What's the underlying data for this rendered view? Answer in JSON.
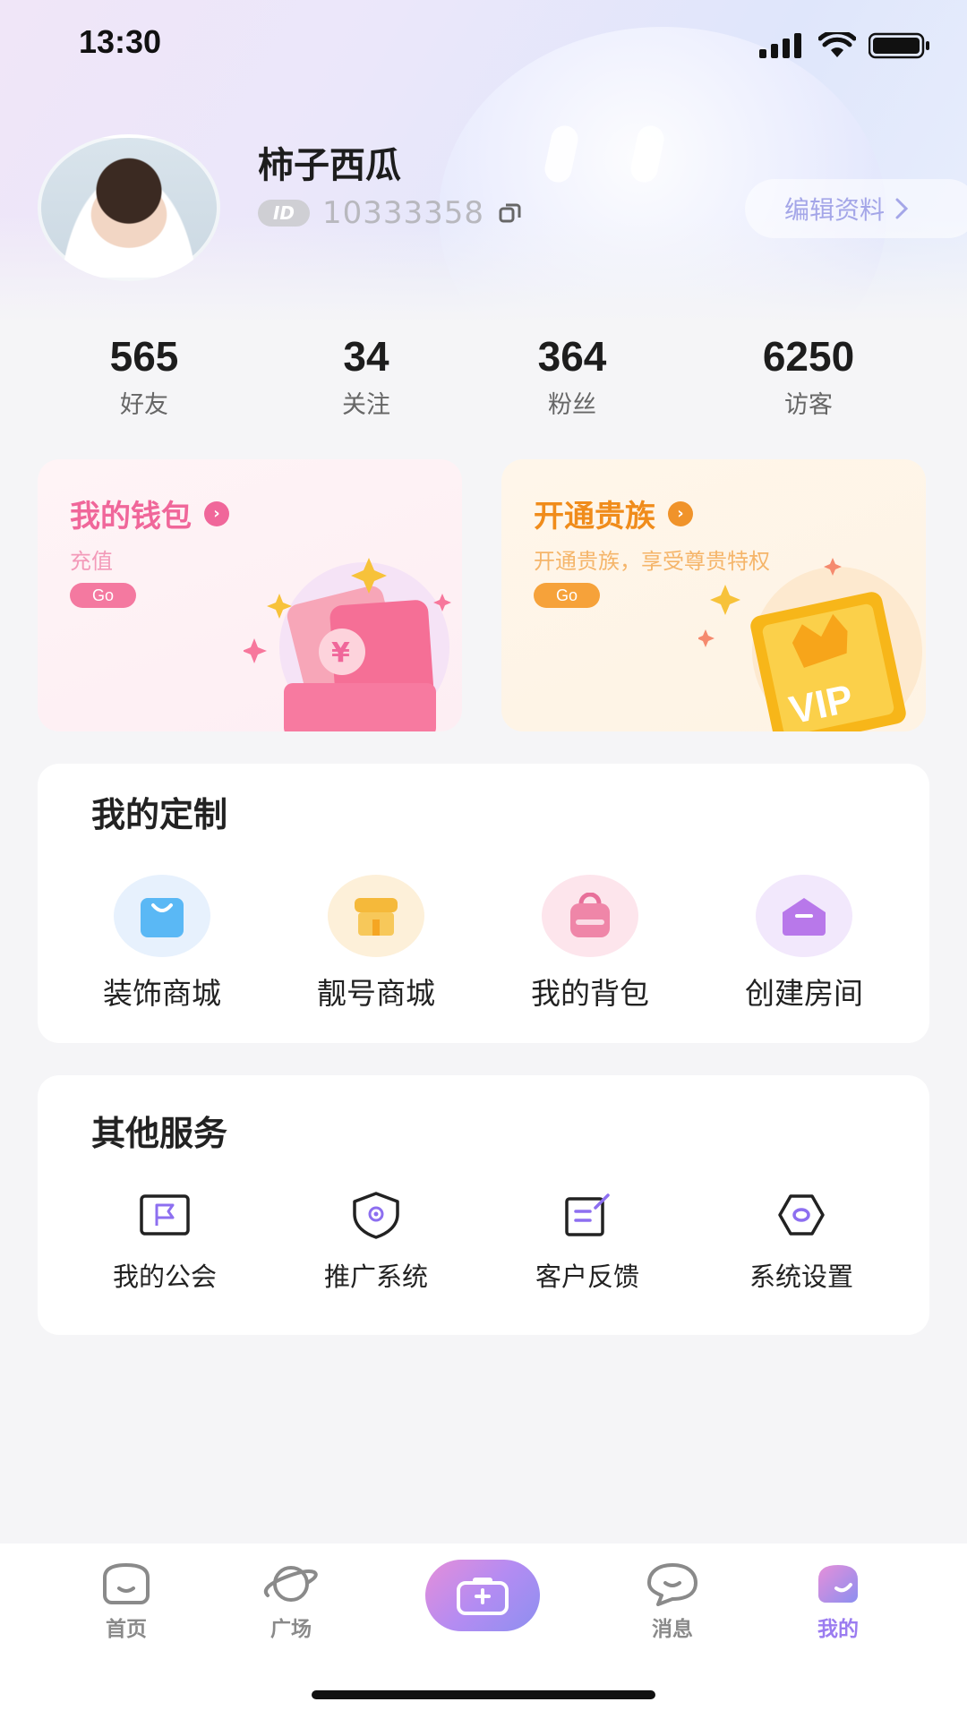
{
  "status_bar": {
    "time": "13:30"
  },
  "profile": {
    "username": "柿子西瓜",
    "id_badge": "ID",
    "id_number": "10333358",
    "edit_label": "编辑资料"
  },
  "stats": [
    {
      "value": "565",
      "label": "好友"
    },
    {
      "value": "34",
      "label": "关注"
    },
    {
      "value": "364",
      "label": "粉丝"
    },
    {
      "value": "6250",
      "label": "访客"
    }
  ],
  "promos": {
    "wallet": {
      "title": "我的钱包",
      "subtitle": "充值",
      "go": "Go",
      "color": "#f0679a"
    },
    "noble": {
      "title": "开通贵族",
      "subtitle": "开通贵族，享受尊贵特权",
      "go": "Go",
      "color": "#f08c1b",
      "badge_text": "VIP"
    }
  },
  "custom_section": {
    "title": "我的定制",
    "items": [
      {
        "label": "装饰商城",
        "icon": "shopping-bag-icon"
      },
      {
        "label": "靓号商城",
        "icon": "store-icon"
      },
      {
        "label": "我的背包",
        "icon": "backpack-icon"
      },
      {
        "label": "创建房间",
        "icon": "envelope-icon"
      }
    ]
  },
  "services_section": {
    "title": "其他服务",
    "items": [
      {
        "label": "我的公会",
        "icon": "flag-icon"
      },
      {
        "label": "推广系统",
        "icon": "shield-gear-icon"
      },
      {
        "label": "客户反馈",
        "icon": "edit-icon"
      },
      {
        "label": "系统设置",
        "icon": "settings-icon"
      }
    ]
  },
  "tabbar": {
    "items": [
      {
        "label": "首页",
        "icon": "home-face-icon"
      },
      {
        "label": "广场",
        "icon": "planet-icon"
      },
      {
        "label": "",
        "icon": "camera-icon"
      },
      {
        "label": "消息",
        "icon": "chat-bubble-icon"
      },
      {
        "label": "我的",
        "icon": "profile-icon",
        "active": true
      }
    ],
    "accent_color": "#9b7cf0"
  }
}
